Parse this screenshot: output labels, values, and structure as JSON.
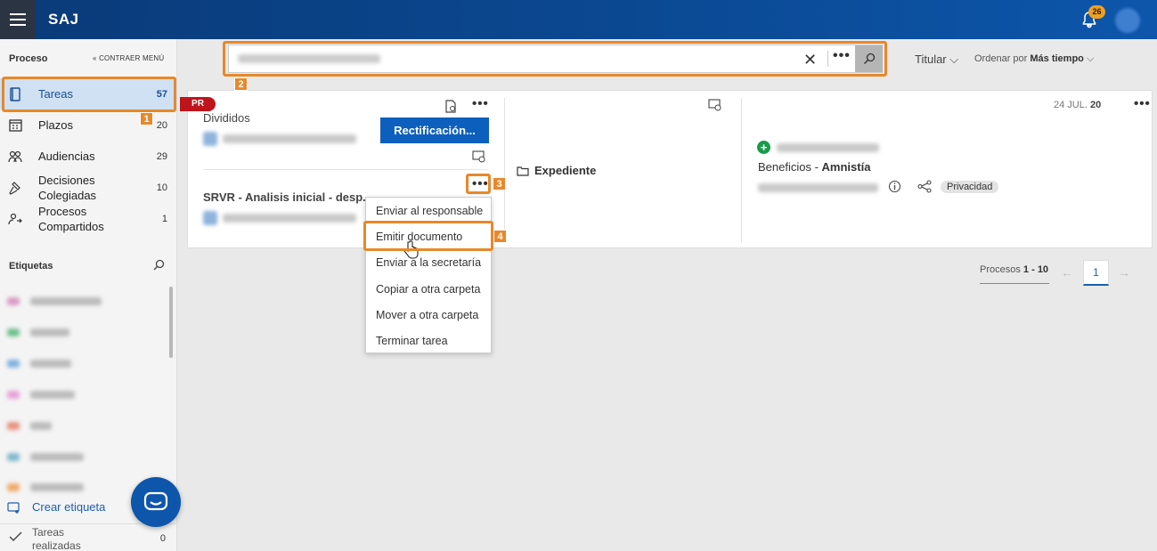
{
  "app": {
    "logo": "SAJ",
    "notification_count": "26"
  },
  "sidebar": {
    "header": "Proceso",
    "collapse_label": "« CONTRAER MENÚ",
    "items": [
      {
        "label": "Tareas",
        "count": "57",
        "icon": "tasks-icon"
      },
      {
        "label": "Plazos",
        "count": "20",
        "icon": "calendar-icon"
      },
      {
        "label": "Audiencias",
        "count": "29",
        "icon": "people-icon"
      },
      {
        "label": "Decisiones Colegiadas",
        "count": "10",
        "icon": "gavel-icon"
      },
      {
        "label": "Procesos Compartidos",
        "count": "1",
        "icon": "shared-icon"
      }
    ],
    "tags_header": "Etiquetas",
    "tag_colors": [
      "#d99ac4",
      "#6fc08f",
      "#7eb2de",
      "#e7a1d8",
      "#e8917f",
      "#7fb9cc",
      "#f0a96a"
    ],
    "create_tag": "Crear etiqueta",
    "done": {
      "label": "Tareas realizadas",
      "count": "0"
    }
  },
  "search": {
    "clear_icon": "close-icon",
    "more_icon": "more-icon",
    "search_icon": "search-icon"
  },
  "toolbar": {
    "titular": "Titular",
    "ordenar_label": "Ordenar por",
    "ordenar_value": "Más tiempo"
  },
  "card": {
    "badge": "PR",
    "group_title": "Divididos",
    "action_button": "Rectificación...",
    "task_title": "SRVR - Analisis inicial - desp...",
    "expediente": "Expediente",
    "date_day": "24 JUL.",
    "date_year": "20",
    "subject_prefix": "Beneficios - ",
    "subject": "Amnistía",
    "privacy_badge": "Privacidad"
  },
  "context_menu": {
    "items": [
      "Enviar al responsable",
      "Emitir documento",
      "Enviar a la secretaría",
      "Copiar a otra carpeta",
      "Mover a otra carpeta",
      "Terminar tarea"
    ]
  },
  "annotations": [
    "1",
    "2",
    "3",
    "4"
  ],
  "pagination": {
    "label": "Procesos",
    "range": "1 - 10",
    "current_page": "1"
  },
  "colors": {
    "accent": "#0d56ab",
    "annotation": "#e8882a",
    "badge_red": "#c0141c"
  }
}
